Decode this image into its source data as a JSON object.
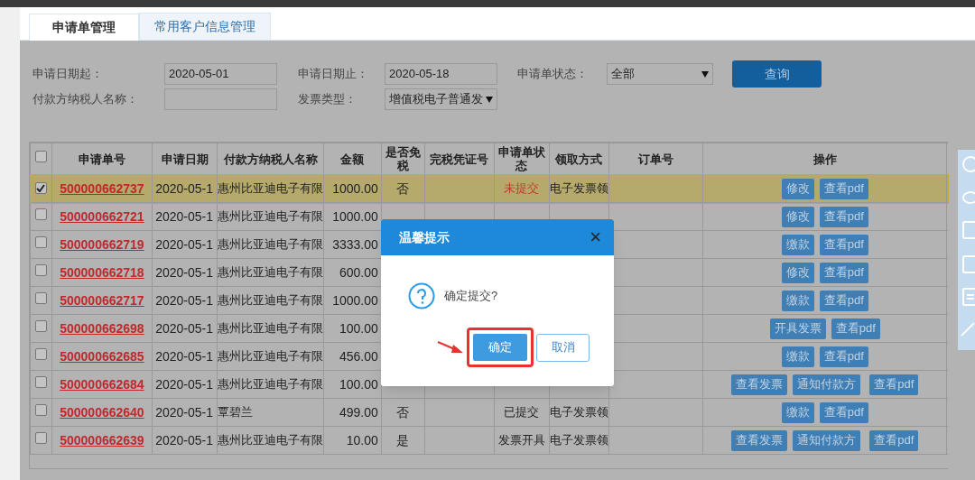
{
  "tabs": [
    {
      "label": "申请单管理",
      "selected": true
    },
    {
      "label": "常用客户信息管理",
      "selected": false
    }
  ],
  "filters": {
    "start_label": "申请日期起：",
    "start_value": "2020-05-01",
    "end_label": "申请日期止：",
    "end_value": "2020-05-18",
    "status_label": "申请单状态：",
    "status_value": "全部",
    "payer_label": "付款方纳税人名称：",
    "invoice_type_label": "发票类型：",
    "invoice_type_value": "增值税电子普通发",
    "search_button": "查询"
  },
  "table": {
    "select_all_checked": false,
    "columns": [
      "申请单号",
      "申请日期",
      "付款方纳税人名称",
      "金额",
      "是否免税",
      "完税凭证号",
      "申请单状态",
      "领取方式",
      "订单号",
      "操作"
    ],
    "rows": [
      {
        "selected": true,
        "number": "500000662737",
        "date": "2020-05-1",
        "payer": "惠州比亚迪电子有限",
        "amount": "1000.00",
        "tax_exempt": "否",
        "status": "未提交",
        "unsubmitted": true,
        "pickup": "电子发票领",
        "actions": [
          "修改",
          "查看pdf"
        ]
      },
      {
        "selected": false,
        "number": "500000662721",
        "date": "2020-05-1",
        "payer": "惠州比亚迪电子有限",
        "amount": "1000.00",
        "actions": [
          "修改",
          "查看pdf"
        ]
      },
      {
        "selected": false,
        "number": "500000662719",
        "date": "2020-05-1",
        "payer": "惠州比亚迪电子有限",
        "amount": "3333.00",
        "actions": [
          "缴款",
          "查看pdf"
        ]
      },
      {
        "selected": false,
        "number": "500000662718",
        "date": "2020-05-1",
        "payer": "惠州比亚迪电子有限",
        "amount": "600.00",
        "actions": [
          "修改",
          "查看pdf"
        ]
      },
      {
        "selected": false,
        "number": "500000662717",
        "date": "2020-05-1",
        "payer": "惠州比亚迪电子有限",
        "amount": "1000.00",
        "actions": [
          "缴款",
          "查看pdf"
        ]
      },
      {
        "selected": false,
        "number": "500000662698",
        "date": "2020-05-1",
        "payer": "惠州比亚迪电子有限",
        "amount": "100.00",
        "actions": [
          "开具发票",
          "查看pdf"
        ]
      },
      {
        "selected": false,
        "number": "500000662685",
        "date": "2020-05-1",
        "payer": "惠州比亚迪电子有限",
        "amount": "456.00",
        "actions": [
          "缴款",
          "查看pdf"
        ]
      },
      {
        "selected": false,
        "number": "500000662684",
        "date": "2020-05-1",
        "payer": "惠州比亚迪电子有限",
        "amount": "100.00",
        "actions": [
          "查看发票",
          "通知付款方",
          "查看pdf"
        ]
      },
      {
        "selected": false,
        "number": "500000662640",
        "date": "2020-05-1",
        "payer": "覃碧兰",
        "amount": "499.00",
        "tax_exempt": "否",
        "status": "已提交",
        "unsubmitted": false,
        "pickup": "电子发票领",
        "actions": [
          "缴款",
          "查看pdf"
        ]
      },
      {
        "selected": false,
        "number": "500000662639",
        "date": "2020-05-1",
        "payer": "惠州比亚迪电子有限",
        "amount": "10.00",
        "tax_exempt": "是",
        "status": "发票开具",
        "unsubmitted": false,
        "pickup": "电子发票领",
        "actions": [
          "查看发票",
          "通知付款方",
          "查看pdf"
        ]
      }
    ]
  },
  "dialog": {
    "title": "温馨提示",
    "close": "×",
    "message": "确定提交?",
    "ok": "确定",
    "cancel": "取消"
  }
}
